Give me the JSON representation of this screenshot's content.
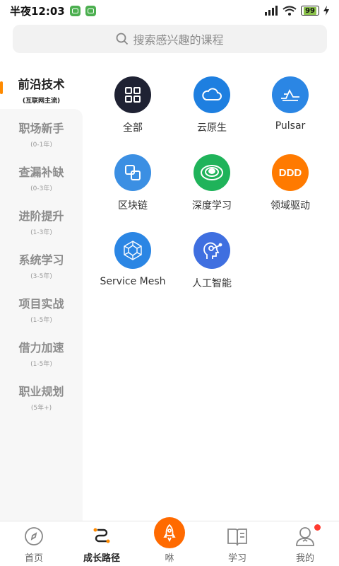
{
  "status": {
    "time": "半夜12:03",
    "battery": "99"
  },
  "search": {
    "placeholder": "搜索感兴趣的课程"
  },
  "sidebar": {
    "items": [
      {
        "label": "前沿技术",
        "sub": "(互联网主流)",
        "active": true
      },
      {
        "label": "职场新手",
        "sub": "(0-1年)"
      },
      {
        "label": "查漏补缺",
        "sub": "(0-3年)"
      },
      {
        "label": "进阶提升",
        "sub": "(1-3年)"
      },
      {
        "label": "系统学习",
        "sub": "(3-5年)"
      },
      {
        "label": "项目实战",
        "sub": "(1-5年)"
      },
      {
        "label": "借力加速",
        "sub": "(1-5年)"
      },
      {
        "label": "职业规划",
        "sub": "(5年+)"
      }
    ]
  },
  "categories": [
    {
      "name": "全部",
      "icon": "grid-icon",
      "color": "#1f2233"
    },
    {
      "name": "云原生",
      "icon": "cloud-icon",
      "color": "#1e7fe0"
    },
    {
      "name": "Pulsar",
      "icon": "pulsar-icon",
      "color": "#2b86e4"
    },
    {
      "name": "区块链",
      "icon": "blockchain-icon",
      "color": "#3b8fe3"
    },
    {
      "name": "深度学习",
      "icon": "deep-learning-icon",
      "color": "#1fb35a"
    },
    {
      "name": "领域驱动",
      "icon": "ddd-icon",
      "color": "#ff7a00",
      "icon_text": "DDD"
    },
    {
      "name": "Service Mesh",
      "icon": "service-mesh-icon",
      "color": "#2b86e4"
    },
    {
      "name": "人工智能",
      "icon": "ai-head-icon",
      "color": "#3f6fe0"
    }
  ],
  "tabbar": {
    "items": [
      {
        "label": "首页",
        "icon": "compass-icon"
      },
      {
        "label": "成长路径",
        "icon": "path-icon",
        "active": true
      },
      {
        "label": "咻",
        "icon": "rocket-icon"
      },
      {
        "label": "学习",
        "icon": "book-icon"
      },
      {
        "label": "我的",
        "icon": "user-icon"
      }
    ]
  },
  "colors": {
    "accent": "#ff8a00",
    "rocket": "#ff6a00",
    "badge": "#ff3b30"
  }
}
